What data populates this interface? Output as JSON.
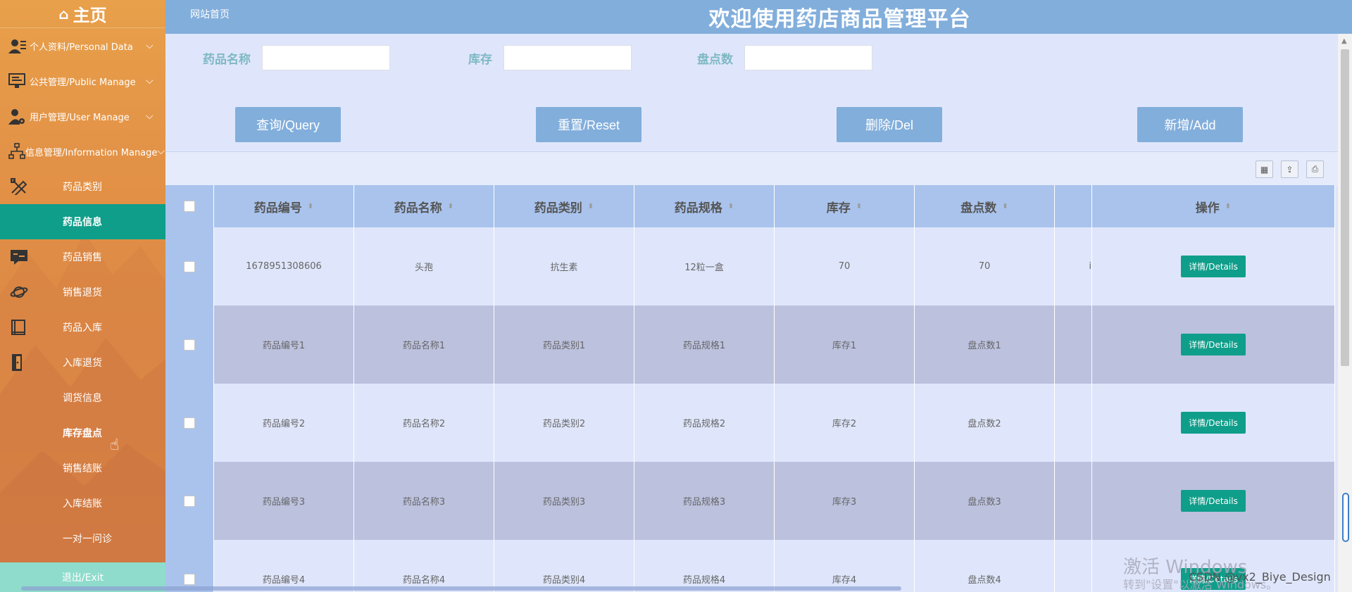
{
  "sidebar": {
    "home": "主页",
    "groups": [
      {
        "label": "个人资料/Personal Data",
        "icon": "user-profile-icon"
      },
      {
        "label": "公共管理/Public Manage",
        "icon": "monitor-icon"
      },
      {
        "label": "用户管理/User Manage",
        "icon": "user-gear-icon"
      },
      {
        "label": "信息管理/Information Manage",
        "icon": "org-chart-icon"
      }
    ],
    "items": [
      {
        "label": "药品类别",
        "icon": "pencil-ruler-icon"
      },
      {
        "label": "药品信息",
        "icon": "",
        "active": true
      },
      {
        "label": "药品销售",
        "icon": "chat-box-icon"
      },
      {
        "label": "销售退货",
        "icon": "planet-icon"
      },
      {
        "label": "药品入库",
        "icon": "book-icon"
      },
      {
        "label": "入库退货",
        "icon": "door-icon"
      },
      {
        "label": "调货信息",
        "icon": ""
      },
      {
        "label": "库存盘点",
        "icon": "",
        "hover": true
      },
      {
        "label": "销售结账",
        "icon": ""
      },
      {
        "label": "入库结账",
        "icon": ""
      },
      {
        "label": "一对一问诊",
        "icon": ""
      }
    ],
    "exit": "退出/Exit"
  },
  "header": {
    "home_link": "网站首页",
    "title": "欢迎使用药店商品管理平台"
  },
  "search": {
    "fields": [
      {
        "label": "药品名称",
        "value": ""
      },
      {
        "label": "库存",
        "value": ""
      },
      {
        "label": "盘点数",
        "value": ""
      }
    ],
    "buttons": [
      "查询/Query",
      "重置/Reset",
      "删除/Del",
      "新增/Add"
    ]
  },
  "table": {
    "headers": [
      "药品编号",
      "药品名称",
      "药品类别",
      "药品规格",
      "库存",
      "盘点数",
      "",
      "操作"
    ],
    "rows": [
      [
        "1678951308606",
        "头孢",
        "抗生素",
        "12粒一盒",
        "70",
        "70",
        "i"
      ],
      [
        "药品编号1",
        "药品名称1",
        "药品类别1",
        "药品规格1",
        "库存1",
        "盘点数1",
        ""
      ],
      [
        "药品编号2",
        "药品名称2",
        "药品类别2",
        "药品规格2",
        "库存2",
        "盘点数2",
        ""
      ],
      [
        "药品编号3",
        "药品名称3",
        "药品类别3",
        "药品规格3",
        "库存3",
        "盘点数3",
        ""
      ],
      [
        "药品编号4",
        "药品名称4",
        "药品类别4",
        "药品规格4",
        "库存4",
        "盘点数4",
        ""
      ]
    ],
    "detail_label": "详情/Details"
  },
  "overlay": {
    "watermark": "激活 Windows",
    "watermark_sub": "转到\"设置\"以激活 Windows。",
    "csdn": "CSDN @vx2_Biye_Design"
  },
  "colors": {
    "header": "#82aedb",
    "active_item": "#0f9e8a",
    "button": "#82aedb",
    "detail_button": "#0f9e8a",
    "label": "#7fb8c4"
  }
}
